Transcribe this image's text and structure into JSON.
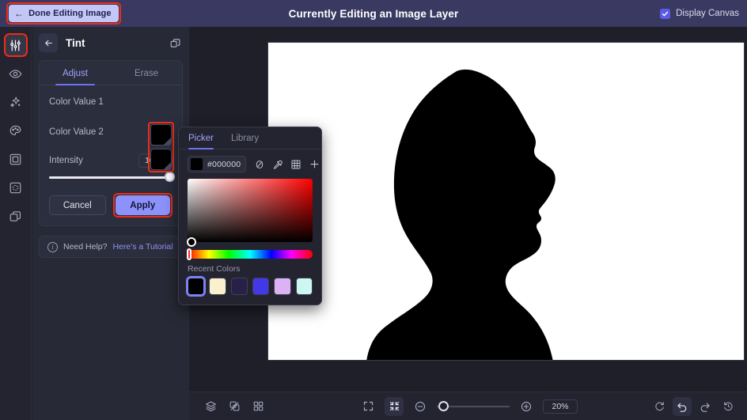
{
  "topbar": {
    "done_button": "Done Editing Image",
    "back_arrow_icon": "arrow-left-icon",
    "title": "Currently Editing an Image Layer",
    "display_canvas_label": "Display Canvas",
    "display_canvas_checked": true,
    "bg_color": "#393962",
    "done_button_bg": "#c3c7f5",
    "highlight_color": "#f02b18"
  },
  "rail": {
    "items": [
      {
        "icon": "sliders-adjust-icon",
        "active": true
      },
      {
        "icon": "eye-icon",
        "active": false
      },
      {
        "icon": "sparkles-icon",
        "active": false
      },
      {
        "icon": "palette-icon",
        "active": false
      },
      {
        "icon": "frame-icon",
        "active": false
      },
      {
        "icon": "blur-frame-icon",
        "active": false
      },
      {
        "icon": "layers-copy-icon",
        "active": false
      }
    ]
  },
  "panel": {
    "back_icon": "arrow-left-icon",
    "title": "Tint",
    "duplicate_icon": "copy-layers-icon",
    "tabs": [
      {
        "label": "Adjust",
        "active": true
      },
      {
        "label": "Erase",
        "active": false
      }
    ],
    "rows": [
      {
        "label": "Color Value 1",
        "color": "#000000"
      },
      {
        "label": "Color Value 2",
        "color": "#000000"
      }
    ],
    "intensity": {
      "label": "Intensity",
      "value": "100%",
      "slider_percent": 100
    },
    "cancel_label": "Cancel",
    "apply_label": "Apply",
    "help": {
      "icon": "info-icon",
      "text": "Need Help?",
      "link": "Here's a Tutorial"
    }
  },
  "picker": {
    "tabs": [
      {
        "label": "Picker",
        "active": true
      },
      {
        "label": "Library",
        "active": false
      }
    ],
    "hex_value": "#000000",
    "swatch_color": "#000000",
    "tools": [
      {
        "icon": "no-color-icon"
      },
      {
        "icon": "eyedropper-icon"
      },
      {
        "icon": "grid-icon"
      },
      {
        "icon": "plus-icon"
      }
    ],
    "recent_colors_label": "Recent Colors",
    "recent_colors": [
      {
        "hex": "#000000",
        "selected": true
      },
      {
        "hex": "#faf0cd",
        "selected": false
      },
      {
        "hex": "#27214a",
        "selected": false
      },
      {
        "hex": "#4338e8",
        "selected": false
      },
      {
        "hex": "#ddb2f5",
        "selected": false
      },
      {
        "hex": "#cdf8f2",
        "selected": false
      }
    ]
  },
  "canvas": {
    "background": "#ffffff",
    "subject": "black-head-silhouette-profile",
    "subject_color": "#000000"
  },
  "bottombar": {
    "left_tools": [
      {
        "icon": "layers-icon"
      },
      {
        "icon": "link-layers-icon"
      },
      {
        "icon": "grid-view-icon"
      }
    ],
    "center_tools": [
      {
        "icon": "fit-expand-icon"
      },
      {
        "icon": "fit-contract-icon"
      }
    ],
    "zoom_out_icon": "zoom-out-icon",
    "zoom_in_icon": "zoom-in-icon",
    "zoom_value": "20%",
    "zoom_slider_percent": 5,
    "right_tools": [
      {
        "icon": "reset-rotate-icon",
        "highlighted": false
      },
      {
        "icon": "undo-icon",
        "highlighted": true
      },
      {
        "icon": "redo-icon",
        "highlighted": false
      },
      {
        "icon": "history-icon",
        "highlighted": false
      }
    ]
  }
}
